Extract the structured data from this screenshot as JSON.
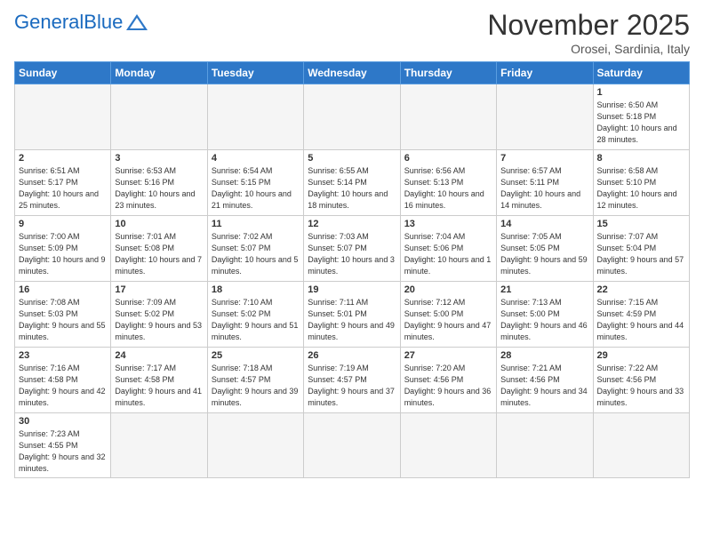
{
  "header": {
    "logo_general": "General",
    "logo_blue": "Blue",
    "month_title": "November 2025",
    "subtitle": "Orosei, Sardinia, Italy"
  },
  "weekdays": [
    "Sunday",
    "Monday",
    "Tuesday",
    "Wednesday",
    "Thursday",
    "Friday",
    "Saturday"
  ],
  "weeks": [
    [
      {
        "day": "",
        "info": ""
      },
      {
        "day": "",
        "info": ""
      },
      {
        "day": "",
        "info": ""
      },
      {
        "day": "",
        "info": ""
      },
      {
        "day": "",
        "info": ""
      },
      {
        "day": "",
        "info": ""
      },
      {
        "day": "1",
        "info": "Sunrise: 6:50 AM\nSunset: 5:18 PM\nDaylight: 10 hours\nand 28 minutes."
      }
    ],
    [
      {
        "day": "2",
        "info": "Sunrise: 6:51 AM\nSunset: 5:17 PM\nDaylight: 10 hours\nand 25 minutes."
      },
      {
        "day": "3",
        "info": "Sunrise: 6:53 AM\nSunset: 5:16 PM\nDaylight: 10 hours\nand 23 minutes."
      },
      {
        "day": "4",
        "info": "Sunrise: 6:54 AM\nSunset: 5:15 PM\nDaylight: 10 hours\nand 21 minutes."
      },
      {
        "day": "5",
        "info": "Sunrise: 6:55 AM\nSunset: 5:14 PM\nDaylight: 10 hours\nand 18 minutes."
      },
      {
        "day": "6",
        "info": "Sunrise: 6:56 AM\nSunset: 5:13 PM\nDaylight: 10 hours\nand 16 minutes."
      },
      {
        "day": "7",
        "info": "Sunrise: 6:57 AM\nSunset: 5:11 PM\nDaylight: 10 hours\nand 14 minutes."
      },
      {
        "day": "8",
        "info": "Sunrise: 6:58 AM\nSunset: 5:10 PM\nDaylight: 10 hours\nand 12 minutes."
      }
    ],
    [
      {
        "day": "9",
        "info": "Sunrise: 7:00 AM\nSunset: 5:09 PM\nDaylight: 10 hours\nand 9 minutes."
      },
      {
        "day": "10",
        "info": "Sunrise: 7:01 AM\nSunset: 5:08 PM\nDaylight: 10 hours\nand 7 minutes."
      },
      {
        "day": "11",
        "info": "Sunrise: 7:02 AM\nSunset: 5:07 PM\nDaylight: 10 hours\nand 5 minutes."
      },
      {
        "day": "12",
        "info": "Sunrise: 7:03 AM\nSunset: 5:07 PM\nDaylight: 10 hours\nand 3 minutes."
      },
      {
        "day": "13",
        "info": "Sunrise: 7:04 AM\nSunset: 5:06 PM\nDaylight: 10 hours\nand 1 minute."
      },
      {
        "day": "14",
        "info": "Sunrise: 7:05 AM\nSunset: 5:05 PM\nDaylight: 9 hours\nand 59 minutes."
      },
      {
        "day": "15",
        "info": "Sunrise: 7:07 AM\nSunset: 5:04 PM\nDaylight: 9 hours\nand 57 minutes."
      }
    ],
    [
      {
        "day": "16",
        "info": "Sunrise: 7:08 AM\nSunset: 5:03 PM\nDaylight: 9 hours\nand 55 minutes."
      },
      {
        "day": "17",
        "info": "Sunrise: 7:09 AM\nSunset: 5:02 PM\nDaylight: 9 hours\nand 53 minutes."
      },
      {
        "day": "18",
        "info": "Sunrise: 7:10 AM\nSunset: 5:02 PM\nDaylight: 9 hours\nand 51 minutes."
      },
      {
        "day": "19",
        "info": "Sunrise: 7:11 AM\nSunset: 5:01 PM\nDaylight: 9 hours\nand 49 minutes."
      },
      {
        "day": "20",
        "info": "Sunrise: 7:12 AM\nSunset: 5:00 PM\nDaylight: 9 hours\nand 47 minutes."
      },
      {
        "day": "21",
        "info": "Sunrise: 7:13 AM\nSunset: 5:00 PM\nDaylight: 9 hours\nand 46 minutes."
      },
      {
        "day": "22",
        "info": "Sunrise: 7:15 AM\nSunset: 4:59 PM\nDaylight: 9 hours\nand 44 minutes."
      }
    ],
    [
      {
        "day": "23",
        "info": "Sunrise: 7:16 AM\nSunset: 4:58 PM\nDaylight: 9 hours\nand 42 minutes."
      },
      {
        "day": "24",
        "info": "Sunrise: 7:17 AM\nSunset: 4:58 PM\nDaylight: 9 hours\nand 41 minutes."
      },
      {
        "day": "25",
        "info": "Sunrise: 7:18 AM\nSunset: 4:57 PM\nDaylight: 9 hours\nand 39 minutes."
      },
      {
        "day": "26",
        "info": "Sunrise: 7:19 AM\nSunset: 4:57 PM\nDaylight: 9 hours\nand 37 minutes."
      },
      {
        "day": "27",
        "info": "Sunrise: 7:20 AM\nSunset: 4:56 PM\nDaylight: 9 hours\nand 36 minutes."
      },
      {
        "day": "28",
        "info": "Sunrise: 7:21 AM\nSunset: 4:56 PM\nDaylight: 9 hours\nand 34 minutes."
      },
      {
        "day": "29",
        "info": "Sunrise: 7:22 AM\nSunset: 4:56 PM\nDaylight: 9 hours\nand 33 minutes."
      }
    ],
    [
      {
        "day": "30",
        "info": "Sunrise: 7:23 AM\nSunset: 4:55 PM\nDaylight: 9 hours\nand 32 minutes."
      },
      {
        "day": "",
        "info": ""
      },
      {
        "day": "",
        "info": ""
      },
      {
        "day": "",
        "info": ""
      },
      {
        "day": "",
        "info": ""
      },
      {
        "day": "",
        "info": ""
      },
      {
        "day": "",
        "info": ""
      }
    ]
  ]
}
